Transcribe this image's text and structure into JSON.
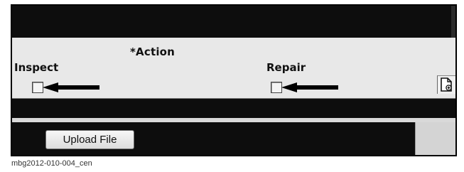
{
  "form": {
    "action_title": "*Action",
    "inspect_label": "Inspect",
    "repair_label": "Repair",
    "inspect_checked": false,
    "repair_checked": false,
    "upload_button_label": "Upload File"
  },
  "icons": {
    "arrow": "left-arrow-icon",
    "document": "document-add-icon"
  },
  "caption": "mbg2012-010-004_cen",
  "colors": {
    "dark_band": "#0d0d0d",
    "row_bg": "#e8e8e8"
  }
}
